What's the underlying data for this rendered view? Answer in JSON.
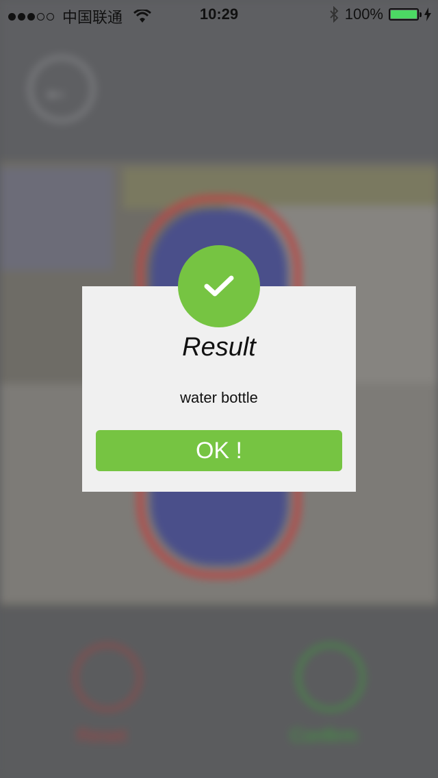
{
  "status_bar": {
    "carrier": "中国联通",
    "time": "10:29",
    "battery": "100%"
  },
  "background": {
    "reset_label": "Reset",
    "confirm_label": "Confirm"
  },
  "dialog": {
    "title": "Result",
    "message": "water bottle",
    "ok_label": "OK !"
  },
  "colors": {
    "accent_green": "#76c442",
    "dialog_bg": "#f0f0f0",
    "battery_green": "#4cd964"
  }
}
